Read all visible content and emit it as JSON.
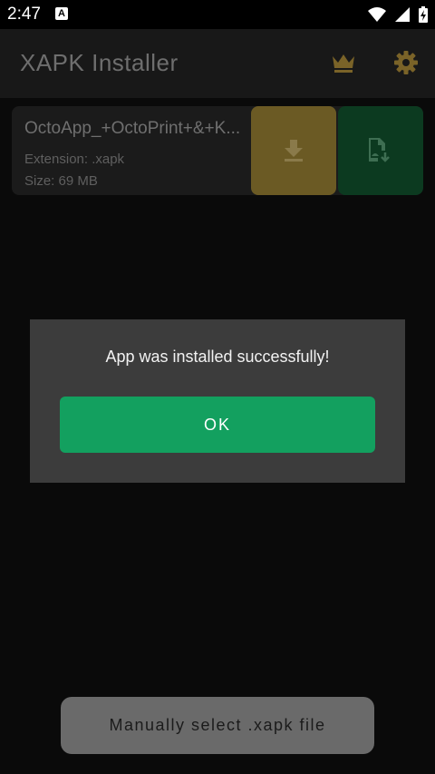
{
  "status_bar": {
    "time": "2:47",
    "notification_icon_letter": "A",
    "icons": [
      "wifi-icon",
      "cell-signal-icon",
      "battery-charging-icon"
    ]
  },
  "app_bar": {
    "title": "XAPK Installer",
    "actions": [
      {
        "icon": "crown-icon",
        "color": "#7a6328"
      },
      {
        "icon": "gear-icon",
        "color": "#7a6328"
      }
    ]
  },
  "file_card": {
    "name": "OctoApp_+OctoPrint+&+K...",
    "extension": "Extension: .xapk",
    "size": "Size: 69 MB",
    "download_button_color": "#6b5a24",
    "install_button_color": "#0c3a20",
    "download_icon": "download-icon",
    "install_icon": "install-file-icon"
  },
  "dialog": {
    "message": "App was installed successfully!",
    "ok_label": "OK",
    "accent_color": "#13a05f"
  },
  "bottom_action": {
    "label": "Manually select .xapk file"
  }
}
